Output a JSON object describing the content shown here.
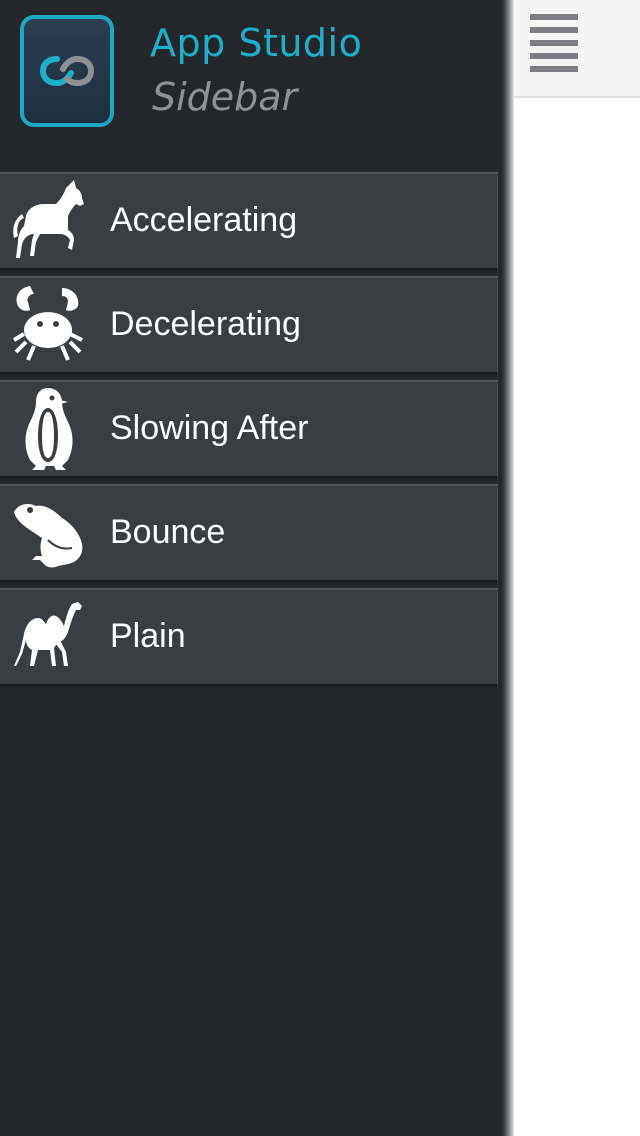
{
  "brand": {
    "title": "App Studio",
    "subtitle": "Sidebar",
    "logo_icon": "infinity-icon"
  },
  "menu": {
    "items": [
      {
        "label": "Accelerating",
        "icon": "horse-icon"
      },
      {
        "label": "Decelerating",
        "icon": "crab-icon"
      },
      {
        "label": "Slowing After",
        "icon": "penguin-icon"
      },
      {
        "label": "Bounce",
        "icon": "frog-icon"
      },
      {
        "label": "Plain",
        "icon": "camel-icon"
      }
    ]
  },
  "topbar": {
    "menu_icon": "hamburger-menu-icon"
  },
  "colors": {
    "sidebar_bg": "#23262b",
    "item_bg": "#3a3e43",
    "accent": "#1fb0c9",
    "subtitle": "#8e9296",
    "label": "#ffffff"
  }
}
